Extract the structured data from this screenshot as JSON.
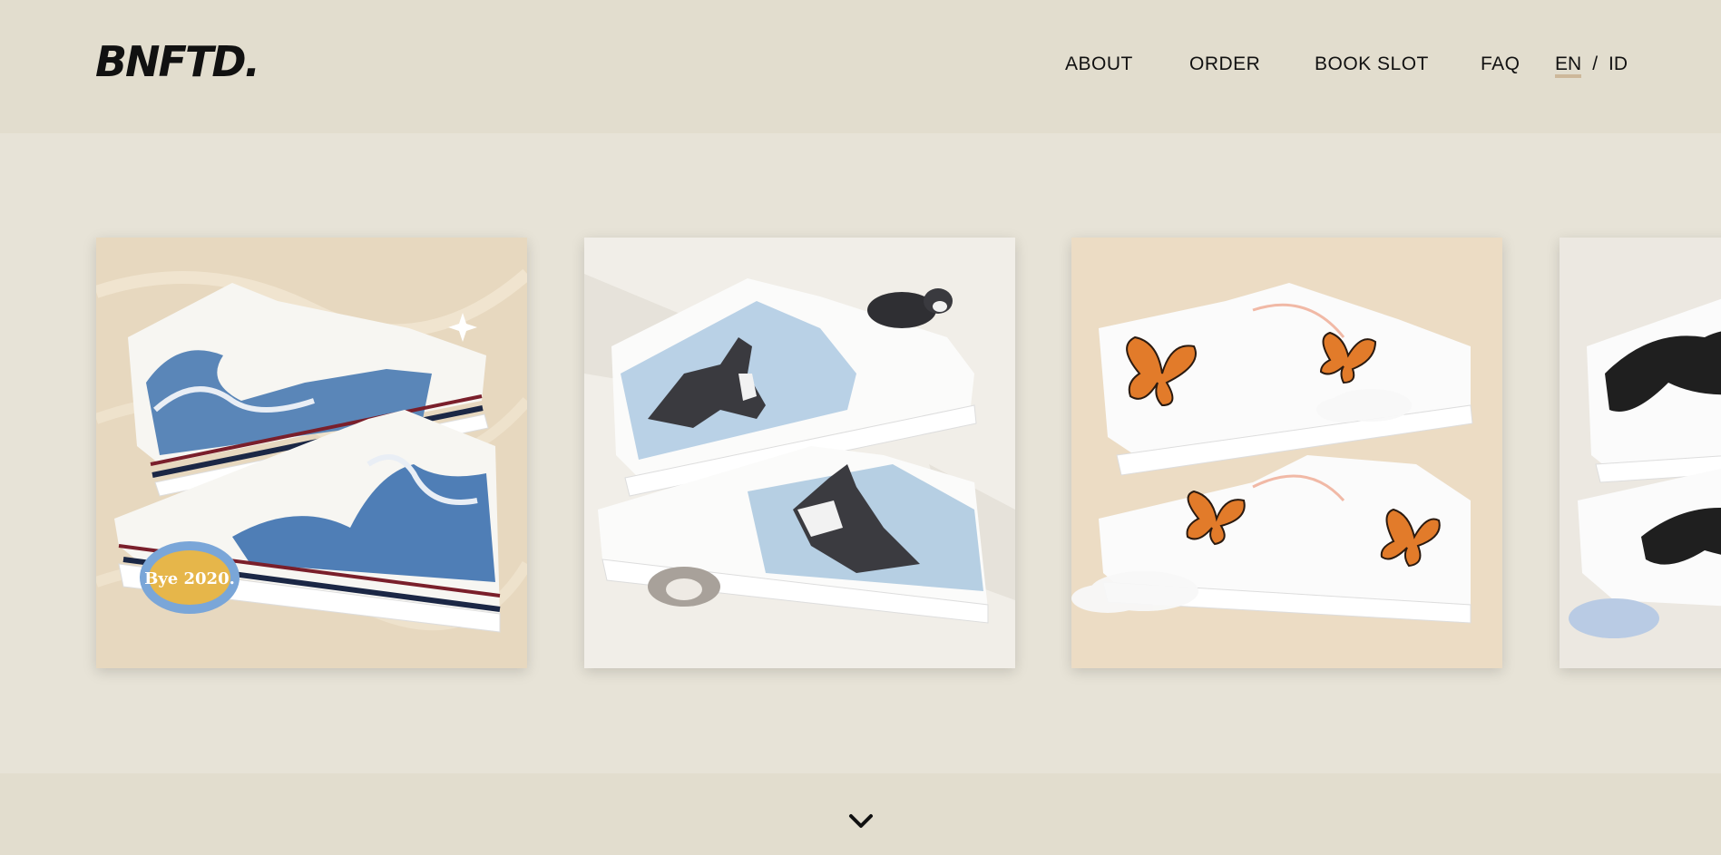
{
  "brand": {
    "logo_text": "BNFTD."
  },
  "nav": {
    "items": [
      {
        "label": "ABOUT"
      },
      {
        "label": "ORDER"
      },
      {
        "label": "BOOK SLOT"
      },
      {
        "label": "FAQ"
      }
    ],
    "languages": {
      "current": "EN",
      "separator": "/",
      "other": "ID"
    }
  },
  "gallery": {
    "cards": [
      {
        "subject": "hand-painted high-top sneakers with great wave",
        "sticker_text": "Bye 2020."
      },
      {
        "subject": "hand-painted low sneakers with husky dogs"
      },
      {
        "subject": "white low sneakers with orange butterflies"
      },
      {
        "subject": "sneakers with black dragon painting"
      }
    ]
  },
  "footer": {
    "icon": "chevron-down-icon"
  },
  "colors": {
    "header_bg": "#e2ddce",
    "page_bg": "#e7e3d7",
    "accent_underline": "#cdb89a"
  }
}
